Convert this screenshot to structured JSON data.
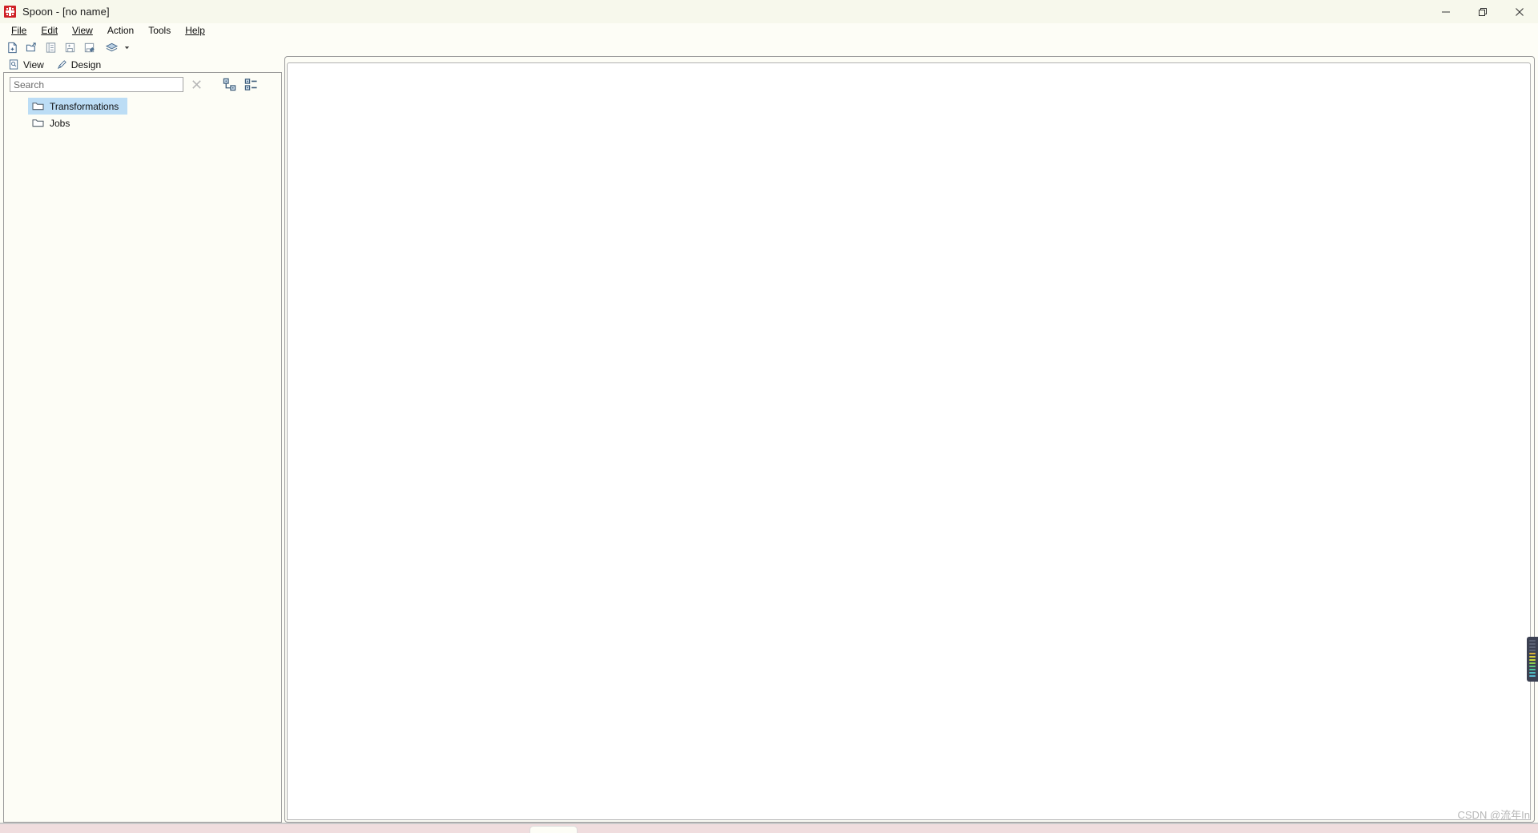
{
  "window": {
    "title": "Spoon - [no name]",
    "app_icon": "spoon-logo-icon",
    "controls": {
      "minimize": "minimize-icon",
      "restore": "restore-icon",
      "close": "close-icon"
    },
    "titlebar_bg": "#f7f8ec"
  },
  "menubar": {
    "items": [
      {
        "label": "File",
        "mnemonic": "F"
      },
      {
        "label": "Edit",
        "mnemonic": "E"
      },
      {
        "label": "View",
        "mnemonic": "V"
      },
      {
        "label": "Action",
        "mnemonic": ""
      },
      {
        "label": "Tools",
        "mnemonic": ""
      },
      {
        "label": "Help",
        "mnemonic": "H"
      }
    ]
  },
  "toolbar": {
    "buttons": [
      {
        "name": "new-file-icon",
        "tooltip": "New"
      },
      {
        "name": "open-file-icon",
        "tooltip": "Open"
      },
      {
        "name": "explore-repository-icon",
        "tooltip": "Explore repository"
      },
      {
        "name": "save-icon",
        "tooltip": "Save"
      },
      {
        "name": "save-as-icon",
        "tooltip": "Save as"
      },
      {
        "name": "layers-icon",
        "tooltip": "Perspectives"
      }
    ],
    "dropdown_caret": "chevron-down-icon"
  },
  "explorer": {
    "tabs": [
      {
        "label": "View",
        "icon": "document-search-icon",
        "active": true
      },
      {
        "label": "Design",
        "icon": "pencil-icon",
        "active": false
      }
    ],
    "search": {
      "placeholder": "Search",
      "value": "",
      "clear_icon": "close-x-icon"
    },
    "view_modes": [
      {
        "name": "hierarchy-view-icon",
        "label": "Tree view"
      },
      {
        "name": "list-view-icon",
        "label": "List view"
      }
    ],
    "tree_items": [
      {
        "label": "Transformations",
        "icon": "folder-icon",
        "selected": true
      },
      {
        "label": "Jobs",
        "icon": "folder-icon",
        "selected": false
      }
    ],
    "selection_color": "#bcddf5"
  },
  "canvas": {
    "content": "",
    "background": "#ffffff"
  },
  "watermark": {
    "text": "CSDN @流年In"
  },
  "overlay": {
    "name": "screen-recorder-widget"
  }
}
